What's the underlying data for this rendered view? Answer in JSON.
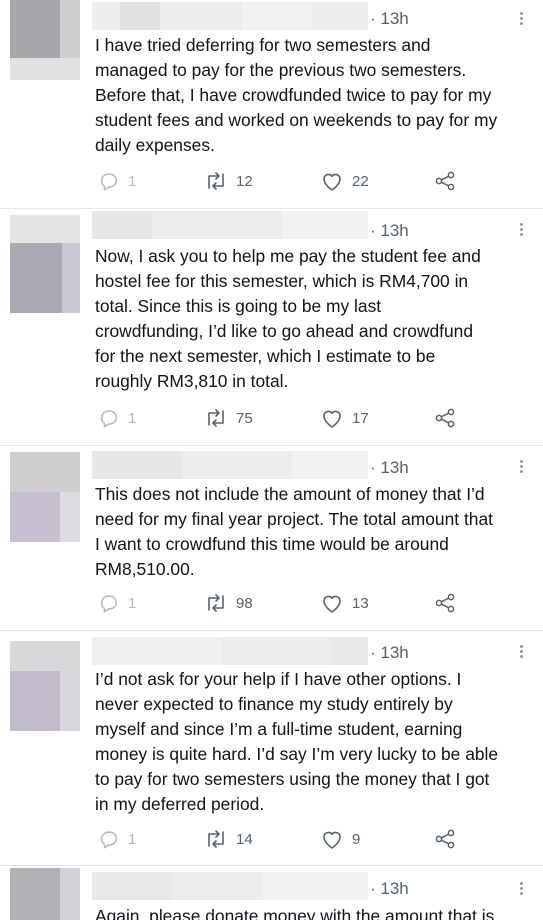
{
  "tweets": [
    {
      "time": "· 13h",
      "text": "I have tried deferring for two semesters and\nmanaged to pay for the previous two semesters.\nBefore that, I have crowdfunded twice to pay for my\nstudent fees and worked on weekends to pay for my\ndaily expenses.",
      "replies": "1",
      "retweets": "12",
      "likes": "22"
    },
    {
      "time": "· 13h",
      "text": "Now, I ask you to help me pay the student fee and\nhostel fee for this semester, which is RM4,700 in\ntotal. Since this is going to be my last\ncrowdfunding, I’d like to go ahead and crowdfund\nfor the next semester, which I estimate to be\nroughly RM3,810 in total.",
      "replies": "1",
      "retweets": "75",
      "likes": "17"
    },
    {
      "time": "· 13h",
      "text": "This does not include the amount of money that I’d\nneed for my final year project. The total amount that\nI want to crowdfund this time would be around\nRM8,510.00.",
      "replies": "1",
      "retweets": "98",
      "likes": "13"
    },
    {
      "time": "· 13h",
      "text": "I’d not ask for your help if I have other options. I\nnever expected to finance my study entirely by\nmyself and since I’m a full-time student, earning\nmoney is quite hard. I’d say I’m very lucky to be able\nto pay for two semesters using the money that I got\nin my deferred period.",
      "replies": "1",
      "retweets": "14",
      "likes": "9"
    },
    {
      "time": "· 13h",
      "text": "Again, please donate money with the amount that is"
    }
  ],
  "icons": {
    "reply": "reply-icon",
    "retweet": "retweet-icon",
    "like": "heart-icon",
    "share": "share-icon",
    "more": "more-options-icon"
  }
}
